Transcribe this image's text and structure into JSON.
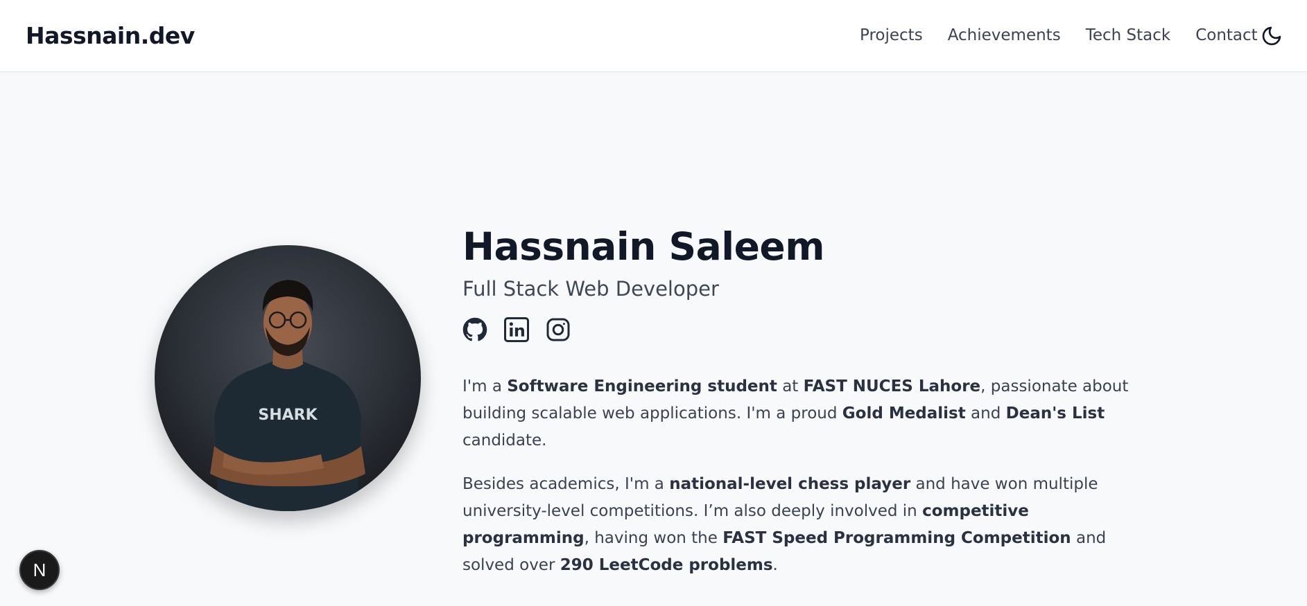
{
  "nav": {
    "brand": "Hassnain.dev",
    "links": [
      "Projects",
      "Achievements",
      "Tech Stack",
      "Contact"
    ],
    "theme_icon": "moon-icon"
  },
  "hero": {
    "name": "Hassnain Saleem",
    "title": "Full Stack Web Developer",
    "socials": [
      {
        "icon": "github-icon"
      },
      {
        "icon": "linkedin-icon"
      },
      {
        "icon": "instagram-icon"
      }
    ],
    "avatar_shirt_text": "SHARK",
    "bio_1": {
      "t1": "I'm a ",
      "b1": "Software Engineering student",
      "t2": " at ",
      "b2": "FAST NUCES Lahore",
      "t3": ", passionate about building scalable web applications. I'm a proud ",
      "b3": "Gold Medalist",
      "t4": " and ",
      "b4": "Dean's List",
      "t5": " candidate."
    },
    "bio_2": {
      "t1": "Besides academics, I'm a ",
      "b1": "national-level chess player",
      "t2": " and have won multiple university-level competitions. I’m also deeply involved in ",
      "b2": "competitive programming",
      "t3": ", having won the ",
      "b3": "FAST Speed Programming Competition",
      "t4": " and solved over ",
      "b4": "290 LeetCode problems",
      "t5": "."
    }
  },
  "devtools": {
    "label": "N"
  },
  "colors": {
    "page_bg": "#f8f9fb",
    "navbar_bg": "#ffffff",
    "text_dark": "#111827",
    "text_body": "#3a4252"
  }
}
